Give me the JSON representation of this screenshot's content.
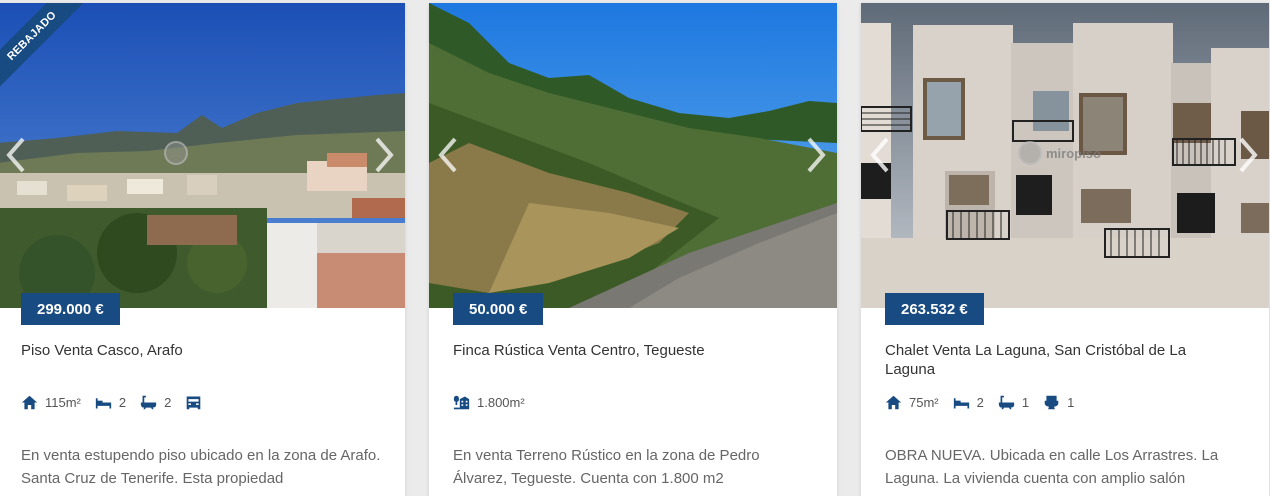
{
  "theme": {
    "accent": "#184b82",
    "icon_color": "#184b82"
  },
  "listings": [
    {
      "badge": "REBAJADO",
      "price": "299.000 €",
      "title": "Piso Venta Casco, Arafo",
      "features": [
        {
          "icon": "house-icon",
          "value": "115m²"
        },
        {
          "icon": "bed-icon",
          "value": "2"
        },
        {
          "icon": "bathtub-icon",
          "value": "2"
        },
        {
          "icon": "garage-icon",
          "value": ""
        }
      ],
      "description": "En venta estupendo piso ubicado en la zona de Arafo. Santa Cruz de Tenerife. Esta propiedad"
    },
    {
      "price": "50.000 €",
      "title": "Finca Rústica Venta Centro, Tegueste",
      "features": [
        {
          "icon": "land-icon",
          "value": "1.800m²"
        }
      ],
      "description": "En venta Terreno Rústico en la zona de Pedro Álvarez, Tegueste. Cuenta con 1.800 m2"
    },
    {
      "price": "263.532 €",
      "title": "Chalet Venta La Laguna, San Cristóbal de La Laguna",
      "watermark": "miropiso",
      "features": [
        {
          "icon": "house-icon",
          "value": "75m²"
        },
        {
          "icon": "bed-icon",
          "value": "2"
        },
        {
          "icon": "bathtub-icon",
          "value": "1"
        },
        {
          "icon": "toilet-icon",
          "value": "1"
        }
      ],
      "description": "OBRA NUEVA. Ubicada en calle Los Arrastres. La Laguna. La vivienda cuenta con amplio salón"
    }
  ]
}
